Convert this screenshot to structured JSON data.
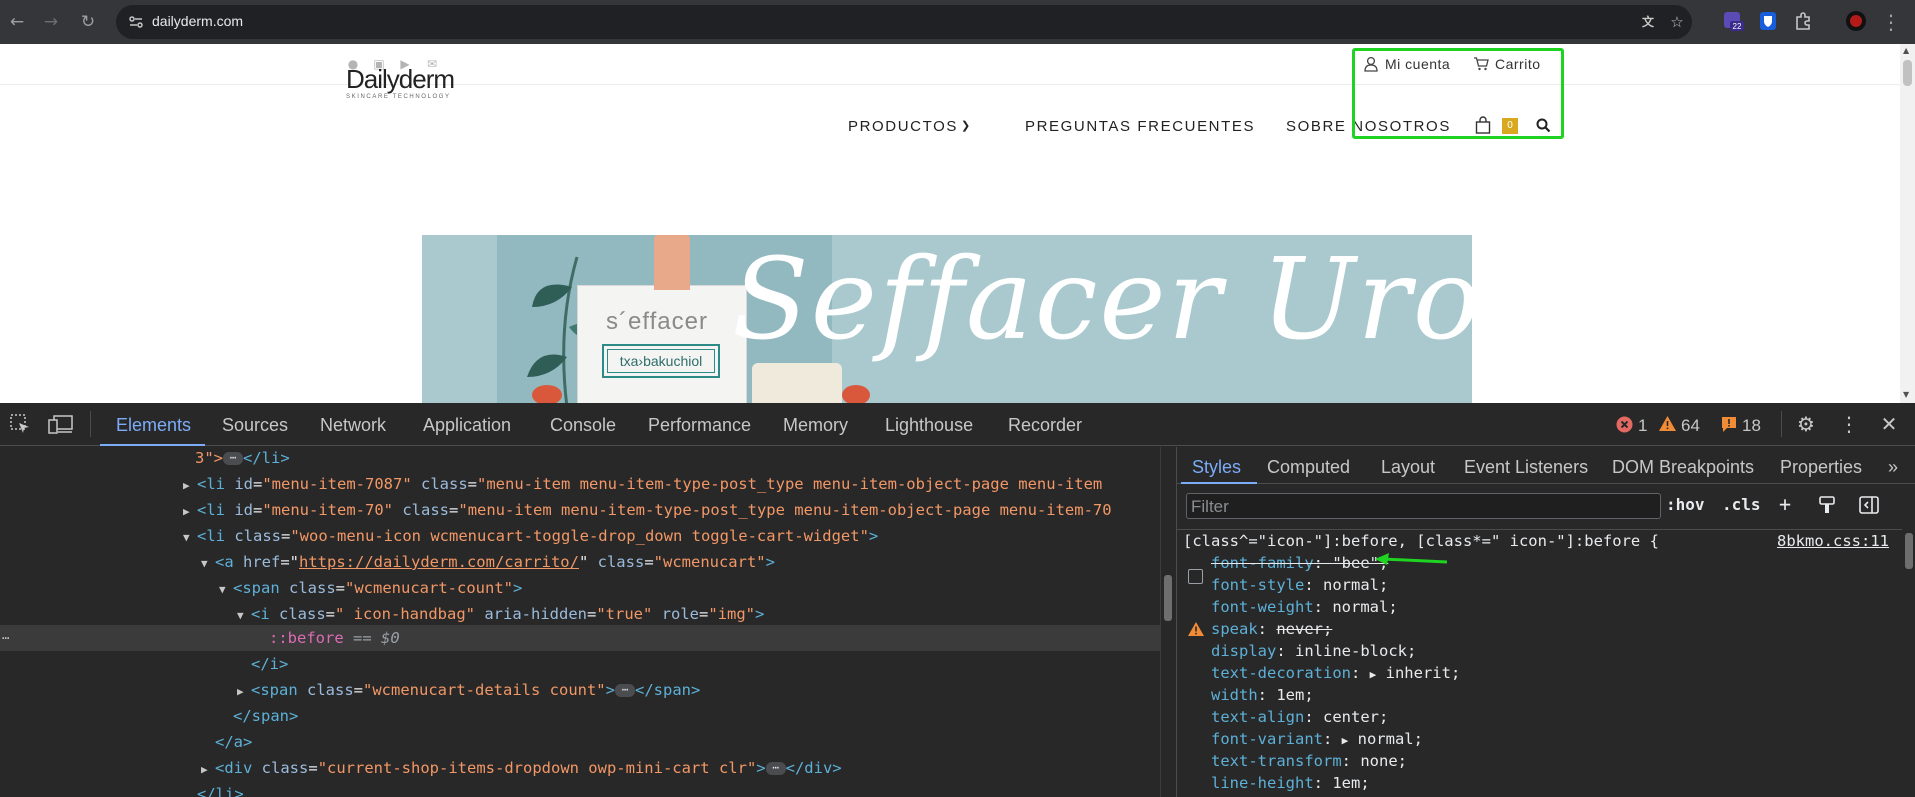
{
  "browser": {
    "url": "dailyderm.com",
    "extension_badge": "22"
  },
  "site": {
    "top_links": {
      "account": "Mi cuenta",
      "cart": "Carrito"
    },
    "logo": {
      "main": "Dailyderm",
      "sub": "SKINCARE TECHNOLOGY"
    },
    "menu": {
      "products": "PRODUCTOS",
      "faq": "PREGUNTAS FRECUENTES",
      "about": "SOBRE NOSOTROS"
    },
    "cart_count": "0",
    "banner": {
      "script_text": "Seffacer Urogine",
      "box_brand": "s´effacer",
      "box_label": "txa›bakuchiol"
    }
  },
  "devtools": {
    "tabs": [
      "Elements",
      "Sources",
      "Network",
      "Application",
      "Console",
      "Performance",
      "Memory",
      "Lighthouse",
      "Recorder"
    ],
    "errors": "1",
    "warnings": "64",
    "issues": "18",
    "elements": {
      "l0_text": "3\">",
      "l0_close": "</li>",
      "l1_open": "<li ",
      "l1_attr1": "id",
      "l1_val1": "\"menu-item-7087\"",
      "l1_attr2": "class",
      "l1_val2": "\"menu-item menu-item-type-post_type menu-item-object-page menu-item",
      "l2_open": "<li ",
      "l2_attr1": "id",
      "l2_val1": "\"menu-item-70\"",
      "l2_attr2": "class",
      "l2_val2": "\"menu-item menu-item-type-post_type menu-item-object-page menu-item-70",
      "l3_open": "<li ",
      "l3_attr": "class",
      "l3_val": "\"woo-menu-icon wcmenucart-toggle-drop_down toggle-cart-widget\"",
      "l3_end": ">",
      "l4_open": "<a ",
      "l4_attr1": "href",
      "l4_link": "https://dailyderm.com/carrito/",
      "l4_attr2": "class",
      "l4_val2": "\"wcmenucart\"",
      "l4_end": ">",
      "l5_open": "<span ",
      "l5_attr": "class",
      "l5_val": "\"wcmenucart-count\"",
      "l5_end": ">",
      "l6_open": "<i ",
      "l6_attr1": "class",
      "l6_val1": "\" icon-handbag\"",
      "l6_attr2": "aria-hidden",
      "l6_val2": "\"true\"",
      "l6_attr3": "role",
      "l6_val3": "\"img\"",
      "l6_end": ">",
      "l7_pseudo": "::before",
      "l7_eq": "== $0",
      "l8": "</i>",
      "l9_open": "<span ",
      "l9_attr": "class",
      "l9_val": "\"wcmenucart-details count\"",
      "l9_end": ">",
      "l9_close": "</span>",
      "l10": "</span>",
      "l11": "</a>",
      "l12_open": "<div ",
      "l12_attr": "class",
      "l12_val": "\"current-shop-items-dropdown owp-mini-cart clr\"",
      "l12_end": ">",
      "l12_close": "</div>",
      "l13": "</li>"
    },
    "styles": {
      "tabs": [
        "Styles",
        "Computed",
        "Layout",
        "Event Listeners",
        "DOM Breakpoints",
        "Properties"
      ],
      "filter_placeholder": "Filter",
      "hov": ":hov",
      "cls": ".cls",
      "selector": "[class^=\"icon-\"]:before, [class*=\" icon-\"]:before {",
      "source": "8bkmo.css:11",
      "declarations": [
        {
          "prop": "font-family",
          "value": "\"bee\";"
        },
        {
          "prop": "font-style",
          "value": "normal;"
        },
        {
          "prop": "font-weight",
          "value": "normal;"
        },
        {
          "prop": "speak",
          "value": "never;"
        },
        {
          "prop": "display",
          "value": "inline-block;"
        },
        {
          "prop": "text-decoration",
          "value": "inherit;"
        },
        {
          "prop": "width",
          "value": "1em;"
        },
        {
          "prop": "text-align",
          "value": "center;"
        },
        {
          "prop": "font-variant",
          "value": "normal;"
        },
        {
          "prop": "text-transform",
          "value": "none;"
        },
        {
          "prop": "line-height",
          "value": "1em;"
        }
      ]
    }
  }
}
